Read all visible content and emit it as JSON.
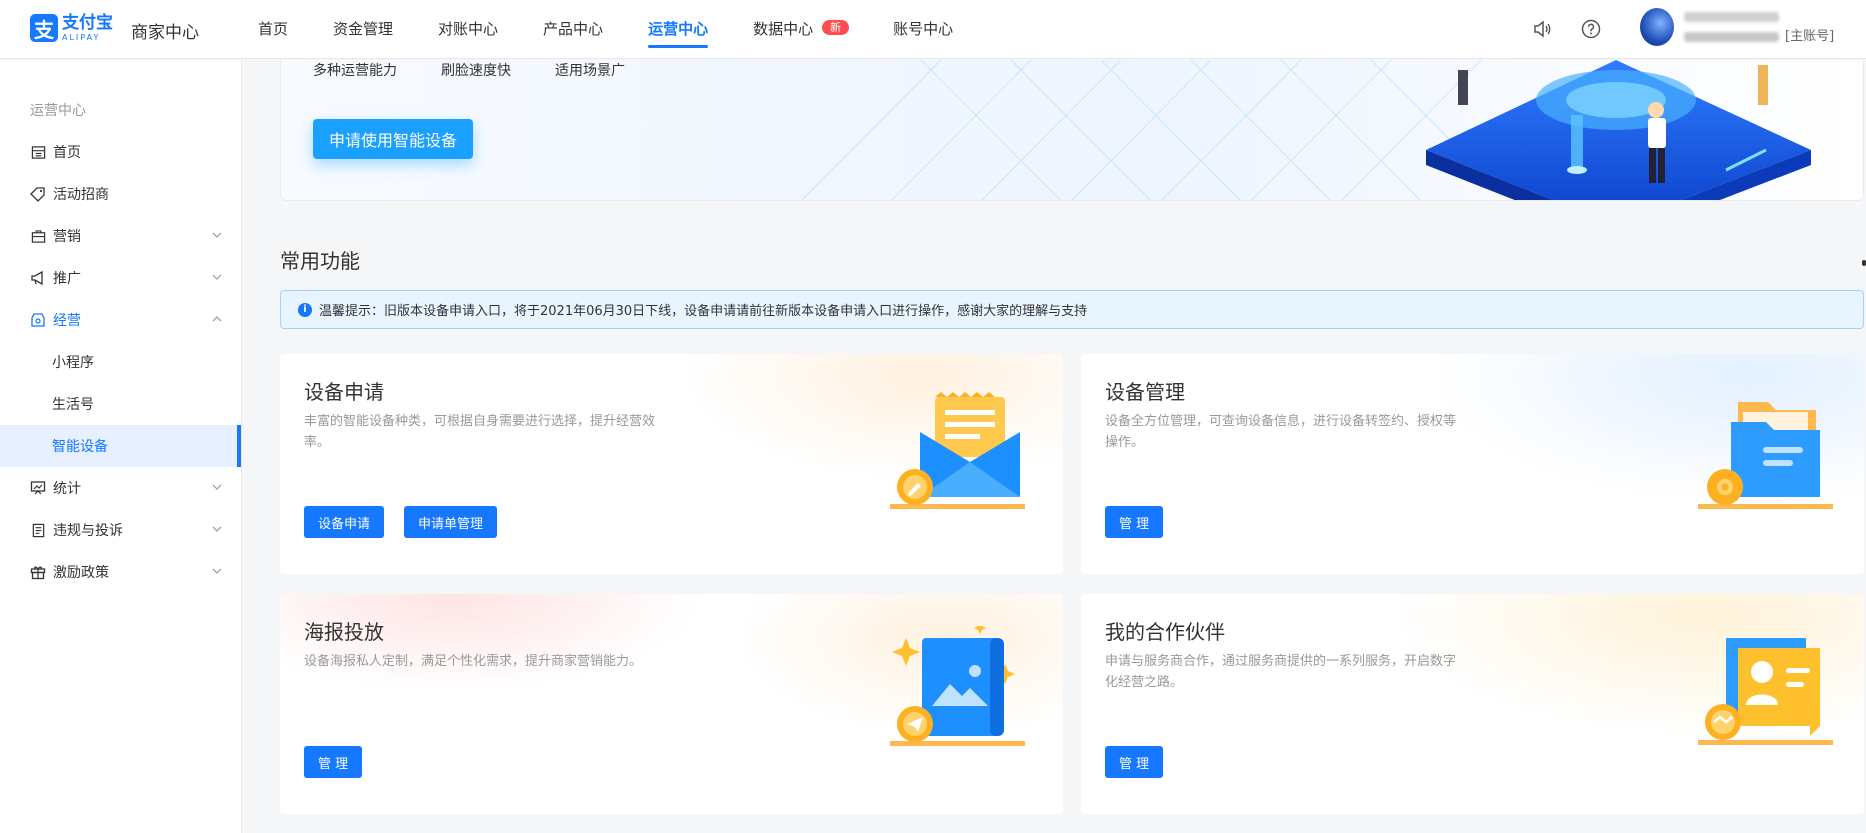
{
  "header": {
    "logo_cn": "支付宝",
    "logo_en": "ALIPAY",
    "brand_sub": "商家中心",
    "nav": [
      {
        "label": "首页"
      },
      {
        "label": "资金管理"
      },
      {
        "label": "对账中心"
      },
      {
        "label": "产品中心"
      },
      {
        "label": "运营中心",
        "active": true
      },
      {
        "label": "数据中心",
        "badge": "新"
      },
      {
        "label": "账号中心"
      }
    ],
    "icons": [
      "speaker-icon",
      "help-icon"
    ],
    "user": {
      "account_type": "[主账号]"
    }
  },
  "sidebar": {
    "title": "运营中心",
    "items": [
      {
        "label": "首页",
        "icon": "home-icon"
      },
      {
        "label": "活动招商",
        "icon": "tag-icon"
      },
      {
        "label": "营销",
        "icon": "briefcase-icon",
        "expandable": true
      },
      {
        "label": "推广",
        "icon": "megaphone-icon",
        "expandable": true
      },
      {
        "label": "经营",
        "icon": "shop-icon",
        "expandable": true,
        "open": true
      },
      {
        "label": "小程序",
        "sub": true
      },
      {
        "label": "生活号",
        "sub": true
      },
      {
        "label": "智能设备",
        "sub": true,
        "selected": true
      },
      {
        "label": "统计",
        "icon": "chart-icon",
        "expandable": true
      },
      {
        "label": "违规与投诉",
        "icon": "document-icon",
        "expandable": true
      },
      {
        "label": "激励政策",
        "icon": "gift-icon",
        "expandable": true
      }
    ]
  },
  "banner": {
    "tags": [
      "多种运营能力",
      "刷脸速度快",
      "适用场景广"
    ],
    "button": "申请使用智能设备"
  },
  "section_title": "常用功能",
  "notice": "温馨提示：旧版本设备申请入口，将于2021年06月30日下线，设备申请请前往新版本设备申请入口进行操作，感谢大家的理解与支持",
  "cards": [
    {
      "title": "设备申请",
      "desc": "丰富的智能设备种类，可根据自身需要进行选择，提升经营效率。",
      "buttons": [
        "设备申请",
        "申请单管理"
      ],
      "icon": "envelope-icon"
    },
    {
      "title": "设备管理",
      "desc": "设备全方位管理，可查询设备信息，进行设备转签约、授权等操作。",
      "buttons": [
        "管 理"
      ],
      "icon": "folder-gear-icon"
    },
    {
      "title": "海报投放",
      "desc": "设备海报私人定制，满足个性化需求，提升商家营销能力。",
      "buttons": [
        "管 理"
      ],
      "icon": "poster-icon"
    },
    {
      "title": "我的合作伙伴",
      "desc": "申请与服务商合作，通过服务商提供的一系列服务，开启数字化经营之路。",
      "buttons": [
        "管 理"
      ],
      "icon": "partner-card-icon"
    }
  ],
  "colors": {
    "primary": "#1677ff",
    "badge": "#ff4d4f",
    "notice_bg": "#e8f4ff"
  }
}
